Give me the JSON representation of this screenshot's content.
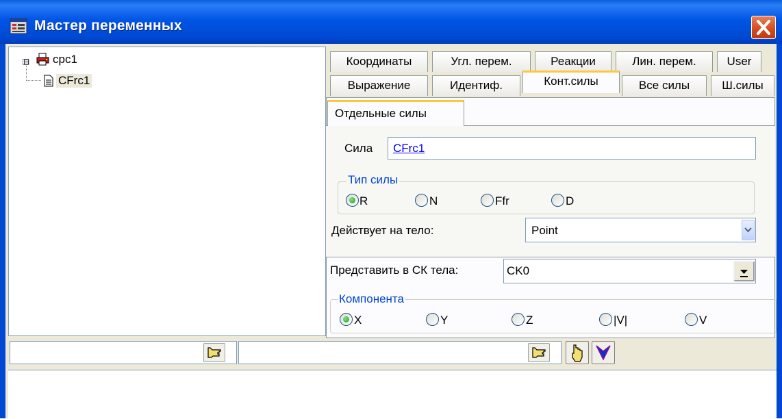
{
  "window": {
    "title": "Мастер переменных",
    "close_icon": "close-icon"
  },
  "tree": {
    "root": {
      "label": "cpc1",
      "expander": "⊟",
      "icon": "printer-icon"
    },
    "child": {
      "label": "CFrc1",
      "icon": "document-icon"
    }
  },
  "tabs_row1": [
    {
      "label": "Координаты"
    },
    {
      "label": "Угл. перем."
    },
    {
      "label": "Реакции"
    },
    {
      "label": "Лин. перем."
    },
    {
      "label": "User"
    }
  ],
  "tabs_row2": [
    {
      "label": "Выражение"
    },
    {
      "label": "Идентиф."
    },
    {
      "label": "Конт.силы",
      "active": true
    },
    {
      "label": "Все силы"
    },
    {
      "label": "Ш.силы"
    }
  ],
  "inner_tab": {
    "label": "Отдельные силы"
  },
  "force": {
    "label": "Сила",
    "value": "CFrc1"
  },
  "force_type": {
    "title": "Тип силы",
    "options": [
      "R",
      "N",
      "Ffr",
      "D"
    ],
    "selected": "R"
  },
  "acts_on": {
    "label": "Действует на тело:",
    "value": "Point"
  },
  "represent": {
    "label": "Представить в СК тела:",
    "value": "CK0"
  },
  "component": {
    "title": "Компонента",
    "options": [
      "X",
      "Y",
      "Z",
      "|V|",
      "V"
    ],
    "selected": "X"
  },
  "colors": {
    "title_bar": "#0055e5",
    "group_title": "#0046d5",
    "link": "#0000ff",
    "active_tab_accent": "#ffc83c"
  }
}
